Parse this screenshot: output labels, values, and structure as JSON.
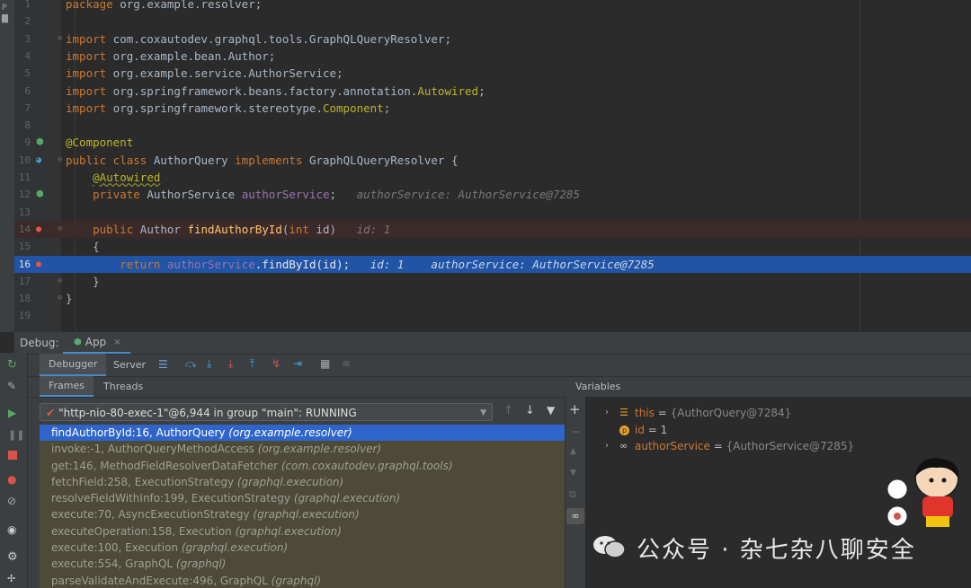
{
  "editor": {
    "lines": [
      {
        "n": "1",
        "html": "<span class=\"kw\">package</span> org.example.resolver;"
      },
      {
        "n": "2",
        "html": ""
      },
      {
        "n": "3",
        "html": "<span class=\"kw\">import</span> com.coxautodev.graphql.tools.GraphQLQueryResolver;"
      },
      {
        "n": "4",
        "html": "<span class=\"kw\">import</span> org.example.bean.Author;"
      },
      {
        "n": "5",
        "html": "<span class=\"kw\">import</span> org.example.service.AuthorService;"
      },
      {
        "n": "6",
        "html": "<span class=\"kw\">import</span> org.springframework.beans.factory.annotation.<span class=\"an\">Autowired</span>;"
      },
      {
        "n": "7",
        "html": "<span class=\"kw\">import</span> org.springframework.stereotype.<span class=\"an\">Component</span>;"
      },
      {
        "n": "8",
        "html": ""
      },
      {
        "n": "9",
        "html": "<span class=\"an\">@Component</span>"
      },
      {
        "n": "10",
        "html": "<span class=\"kw\">public class</span> AuthorQuery <span class=\"kw\">implements</span> GraphQLQueryResolver {"
      },
      {
        "n": "11",
        "html": "    <span class=\"an\" style=\"text-decoration:underline wavy #8a8a30\">@Autowired</span>"
      },
      {
        "n": "12",
        "html": "    <span class=\"kw\">private</span> AuthorService <span class=\"fld\">authorService</span>;   <span class=\"inl\">authorService: AuthorService@7285</span>"
      },
      {
        "n": "13",
        "html": ""
      },
      {
        "n": "14",
        "html": "    <span class=\"kw\">public</span> Author <span style=\"color:#ffc66d\">findAuthorById</span>(<span class=\"kw\">int</span> id)   <span class=\"inl\">id: 1</span>"
      },
      {
        "n": "15",
        "html": "    {"
      },
      {
        "n": "16",
        "html": "        <span class=\"kw\">return</span> <span class=\"fld\">authorService</span>.findById(id);   <span class=\"inl\">id: 1    authorService: AuthorService@7285</span>"
      },
      {
        "n": "17",
        "html": "    }"
      },
      {
        "n": "18",
        "html": "}"
      },
      {
        "n": "19",
        "html": ""
      }
    ]
  },
  "debug": {
    "label": "Debug:",
    "config_tab": "App",
    "tabs": [
      "Debugger",
      "Server"
    ],
    "subtabs": [
      "Frames",
      "Threads"
    ],
    "variables_label": "Variables",
    "thread": "\"http-nio-80-exec-1\"@6,944 in group \"main\": RUNNING",
    "frames": [
      {
        "method": "findAuthorById:16, AuthorQuery",
        "pkg": "(org.example.resolver)"
      },
      {
        "method": "invoke:-1, AuthorQueryMethodAccess",
        "pkg": "(org.example.resolver)"
      },
      {
        "method": "get:146, MethodFieldResolverDataFetcher",
        "pkg": "(com.coxautodev.graphql.tools)"
      },
      {
        "method": "fetchField:258, ExecutionStrategy",
        "pkg": "(graphql.execution)"
      },
      {
        "method": "resolveFieldWithInfo:199, ExecutionStrategy",
        "pkg": "(graphql.execution)"
      },
      {
        "method": "execute:70, AsyncExecutionStrategy",
        "pkg": "(graphql.execution)"
      },
      {
        "method": "executeOperation:158, Execution",
        "pkg": "(graphql.execution)"
      },
      {
        "method": "execute:100, Execution",
        "pkg": "(graphql.execution)"
      },
      {
        "method": "execute:554, GraphQL",
        "pkg": "(graphql)"
      },
      {
        "method": "parseValidateAndExecute:496, GraphQL",
        "pkg": "(graphql)"
      }
    ],
    "variables": [
      {
        "name": "this",
        "eq": " = ",
        "value": "{AuthorQuery@7284}"
      },
      {
        "name": "id",
        "eq": " = ",
        "value": "1"
      },
      {
        "name": "authorService",
        "eq": " = ",
        "value": "{AuthorService@7285}"
      }
    ]
  },
  "watermark": "公众号 · 杂七杂八聊安全",
  "colors": {
    "keyword": "#cc7832",
    "annotation": "#bbb529",
    "field": "#9876aa",
    "selection": "#2154a5"
  }
}
